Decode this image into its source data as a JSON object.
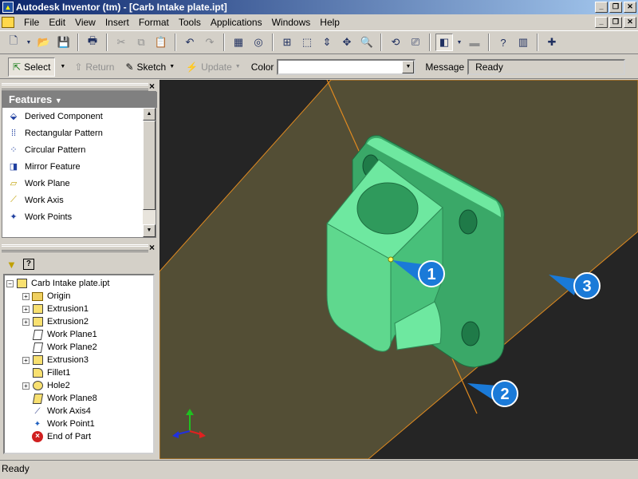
{
  "window": {
    "title": "Autodesk Inventor (tm) - [Carb Intake plate.ipt]",
    "controls": [
      "_",
      "❐",
      "✕"
    ]
  },
  "menu": [
    "File",
    "Edit",
    "View",
    "Insert",
    "Format",
    "Tools",
    "Applications",
    "Windows",
    "Help"
  ],
  "command_bar": {
    "select_label": "Select",
    "return_label": "Return",
    "sketch_label": "Sketch",
    "update_label": "Update",
    "color_label": "Color",
    "color_value": "",
    "message_label": "Message",
    "message_value": "Ready"
  },
  "features_panel": {
    "header": "Features",
    "items": [
      {
        "label": "Derived Component",
        "icon": "derived-component-icon"
      },
      {
        "label": "Rectangular Pattern",
        "icon": "rectangular-pattern-icon"
      },
      {
        "label": "Circular Pattern",
        "icon": "circular-pattern-icon"
      },
      {
        "label": "Mirror Feature",
        "icon": "mirror-feature-icon"
      },
      {
        "label": "Work Plane",
        "icon": "work-plane-icon"
      },
      {
        "label": "Work Axis",
        "icon": "work-axis-icon"
      },
      {
        "label": "Work Points",
        "icon": "work-points-icon"
      }
    ]
  },
  "browser": {
    "root": "Carb Intake plate.ipt",
    "items": [
      {
        "label": "Origin",
        "icon": "folder-icon"
      },
      {
        "label": "Extrusion1",
        "icon": "extrusion-icon"
      },
      {
        "label": "Extrusion2",
        "icon": "extrusion-icon"
      },
      {
        "label": "Work Plane1",
        "icon": "work-plane-icon"
      },
      {
        "label": "Work Plane2",
        "icon": "work-plane-icon"
      },
      {
        "label": "Extrusion3",
        "icon": "extrusion-icon"
      },
      {
        "label": "Fillet1",
        "icon": "fillet-icon"
      },
      {
        "label": "Hole2",
        "icon": "hole-icon"
      },
      {
        "label": "Work Plane8",
        "icon": "work-plane-icon"
      },
      {
        "label": "Work Axis4",
        "icon": "work-axis-icon"
      },
      {
        "label": "Work Point1",
        "icon": "work-point-icon"
      },
      {
        "label": "End of Part",
        "icon": "end-of-part-icon"
      }
    ]
  },
  "callouts": [
    "1",
    "2",
    "3"
  ],
  "status": "Ready",
  "colors": {
    "part": "#5fd88e",
    "part_dark": "#3aa868",
    "work_plane": "#5c5638",
    "work_axis": "#e08a20",
    "viewport_bg": "#252525",
    "callout": "#1a7ad8"
  }
}
